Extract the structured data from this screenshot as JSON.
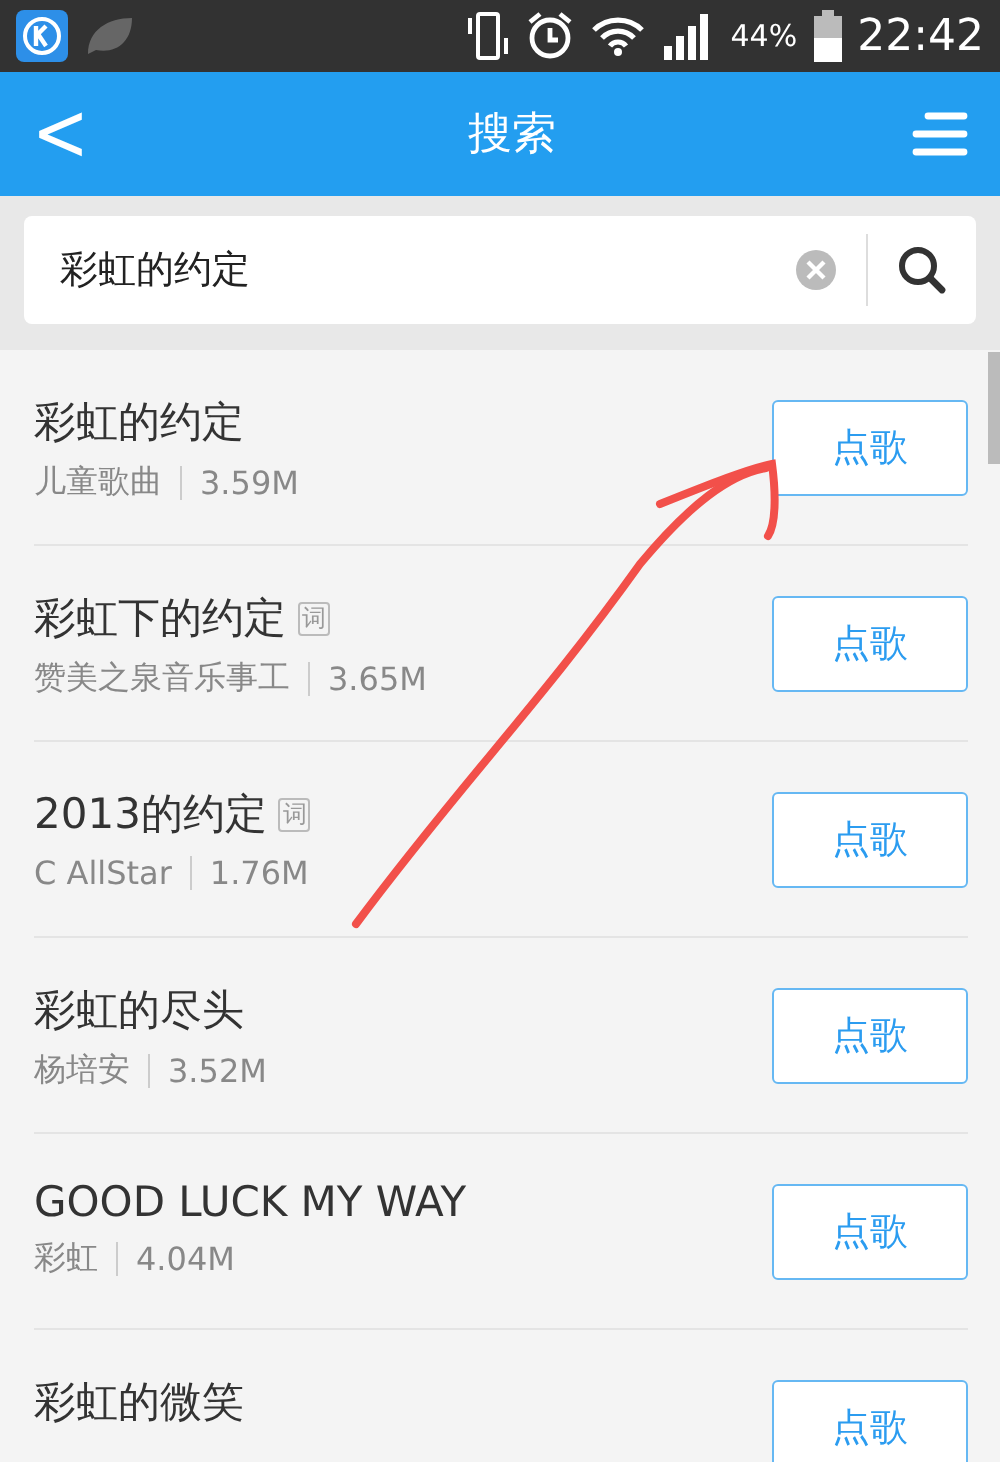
{
  "status_bar": {
    "battery": "44%",
    "time": "22:42"
  },
  "header": {
    "back": "<",
    "title": "搜索"
  },
  "search": {
    "value": "彩虹的约定"
  },
  "results": [
    {
      "title": "彩虹的约定",
      "artist": "儿童歌曲",
      "size": "3.59M",
      "action": "点歌"
    },
    {
      "title": "彩虹下的约定",
      "badge": "词",
      "artist": "赞美之泉音乐事工",
      "size": "3.65M",
      "action": "点歌"
    },
    {
      "title": "2013的约定",
      "badge": "词",
      "artist": "C AllStar",
      "size": "1.76M",
      "action": "点歌"
    },
    {
      "title": "彩虹的尽头",
      "artist": "杨培安",
      "size": "3.52M",
      "action": "点歌"
    },
    {
      "title": "GOOD LUCK MY WAY",
      "artist": "彩虹",
      "size": "4.04M",
      "action": "点歌"
    },
    {
      "title": "彩虹的微笑",
      "action": "点歌"
    }
  ]
}
